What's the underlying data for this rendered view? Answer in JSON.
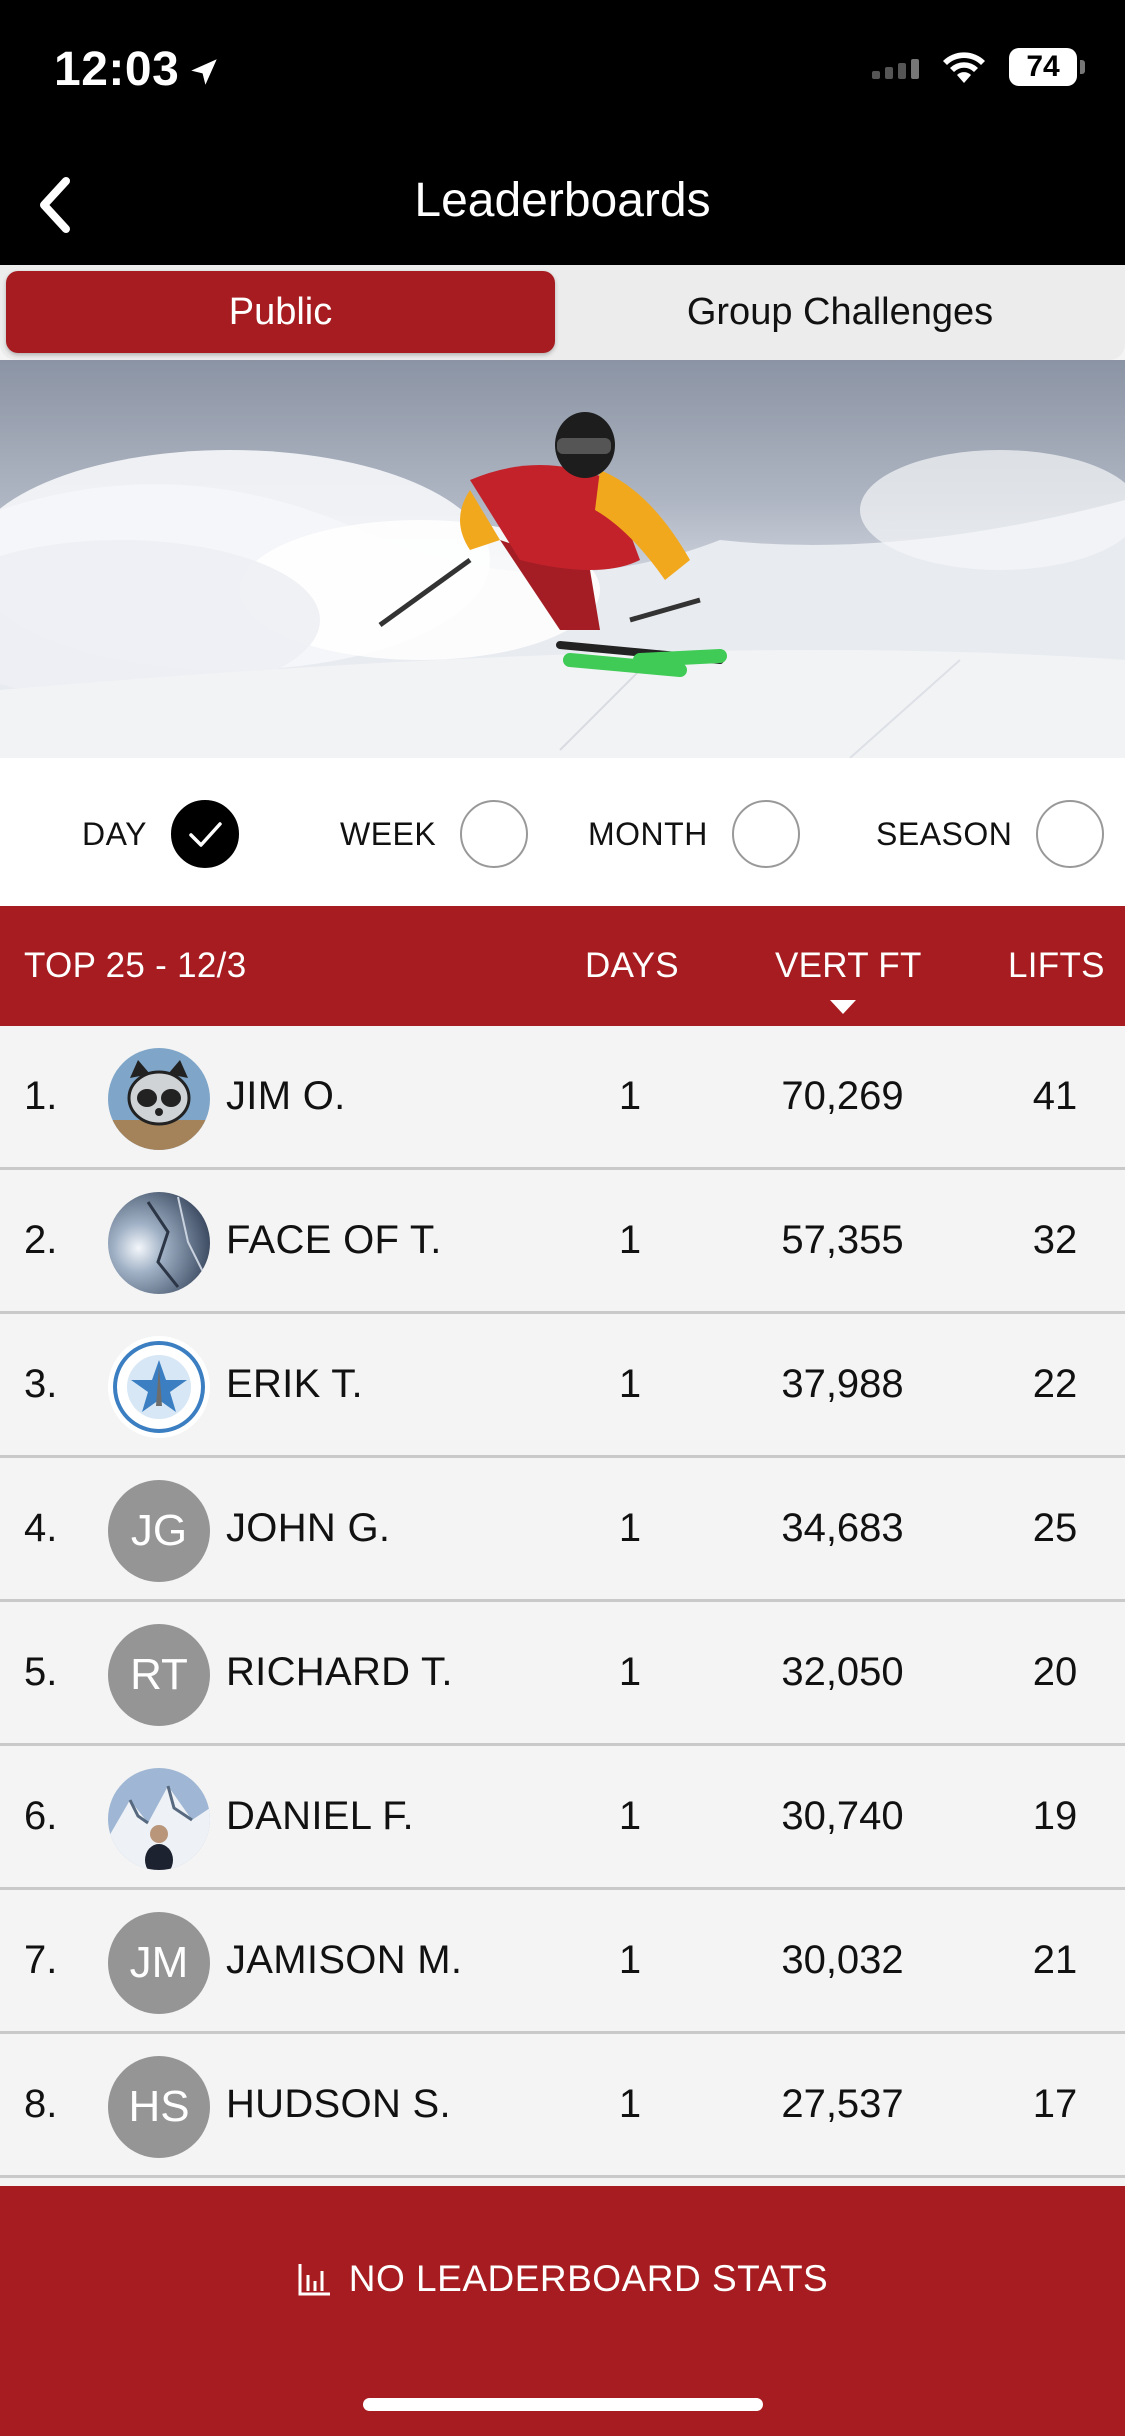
{
  "status_bar": {
    "time": "12:03",
    "battery": "74"
  },
  "nav": {
    "title": "Leaderboards"
  },
  "segments": {
    "public": "Public",
    "group": "Group Challenges"
  },
  "filters": [
    {
      "label": "DAY",
      "checked": true
    },
    {
      "label": "WEEK",
      "checked": false
    },
    {
      "label": "MONTH",
      "checked": false
    },
    {
      "label": "SEASON",
      "checked": false
    }
  ],
  "table": {
    "title": "TOP 25 - 12/3",
    "col_days": "DAYS",
    "col_vert": "VERT FT",
    "col_lifts": "LIFTS",
    "rows": [
      {
        "rank": "1.",
        "name": "JIM O.",
        "days": "1",
        "vert": "70,269",
        "lifts": "41",
        "avatar": "raccoon-photo",
        "initials": ""
      },
      {
        "rank": "2.",
        "name": "FACE OF T.",
        "days": "1",
        "vert": "57,355",
        "lifts": "32",
        "avatar": "rock-photo",
        "initials": ""
      },
      {
        "rank": "3.",
        "name": "ERIK T.",
        "days": "1",
        "vert": "37,988",
        "lifts": "22",
        "avatar": "emblem-photo",
        "initials": ""
      },
      {
        "rank": "4.",
        "name": "JOHN G.",
        "days": "1",
        "vert": "34,683",
        "lifts": "25",
        "avatar": "initials",
        "initials": "JG"
      },
      {
        "rank": "5.",
        "name": "RICHARD T.",
        "days": "1",
        "vert": "32,050",
        "lifts": "20",
        "avatar": "initials",
        "initials": "RT"
      },
      {
        "rank": "6.",
        "name": "DANIEL F.",
        "days": "1",
        "vert": "30,740",
        "lifts": "19",
        "avatar": "mountain-photo",
        "initials": ""
      },
      {
        "rank": "7.",
        "name": "JAMISON M.",
        "days": "1",
        "vert": "30,032",
        "lifts": "21",
        "avatar": "initials",
        "initials": "JM"
      },
      {
        "rank": "8.",
        "name": "HUDSON S.",
        "days": "1",
        "vert": "27,537",
        "lifts": "17",
        "avatar": "initials",
        "initials": "HS"
      }
    ]
  },
  "footer": {
    "stats_label": "NO LEADERBOARD STATS"
  },
  "colors": {
    "brand_red": "#a71c20",
    "initials_gray": "#959595"
  }
}
